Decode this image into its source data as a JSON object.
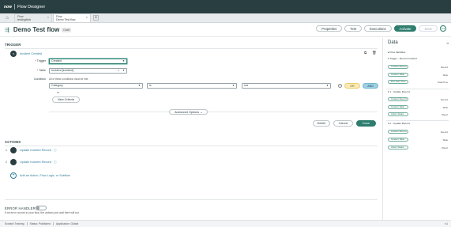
{
  "topbar": {
    "brand": "now",
    "title": "Flow Designer"
  },
  "tabs": [
    {
      "line1": "Flow",
      "line2": "testingHub",
      "active": false
    },
    {
      "line1": "Flow",
      "line2": "Demo Test flow",
      "active": true
    }
  ],
  "header": {
    "title": "Demo Test flow",
    "status": "Draft",
    "buttons": {
      "properties": "Properties",
      "test": "Test",
      "executions": "Executions",
      "activate": "Activate",
      "save": "Save"
    }
  },
  "trigger": {
    "section": "TRIGGER",
    "name": "Incident Created",
    "trigger_label": "Trigger",
    "trigger_value": "Created",
    "table_label": "Table",
    "table_value": "Incident [incident]",
    "condition_label": "Condition",
    "condition_hint": "All of these conditions must be met",
    "condition": {
      "field": "Category",
      "operator": "is",
      "value": "n/a"
    },
    "or_label": "OR",
    "and_label": "AND",
    "or_text": "or",
    "new_criteria": "New Criteria",
    "advanced": "Advanced Options",
    "delete": "Delete",
    "cancel": "Cancel",
    "done": "Done"
  },
  "actions": {
    "section": "ACTIONS",
    "items": [
      {
        "num": "1",
        "name": "Update Incident Record"
      },
      {
        "num": "2",
        "name": "Update Incident Record"
      }
    ],
    "add_label": "Add an Action, Flow Logic, or Subflow"
  },
  "error_handler": {
    "label": "ERROR HANDLER",
    "desc": "If an error occurs in your flow, the actions you add here will run.",
    "enabled": false
  },
  "data_panel": {
    "title": "Data",
    "groups": [
      {
        "label": "Flow Variables",
        "pills": []
      },
      {
        "label": "Trigger - Record Created",
        "pills": [
          {
            "label": "Incident Record",
            "type": "Record"
          },
          {
            "label": "Incident Table",
            "type": "Table"
          },
          {
            "label": "Run Start Time",
            "type": "Date/Time"
          }
        ]
      },
      {
        "label": "1 - Update Record",
        "pills": [
          {
            "label": "Incident Record",
            "type": "Record"
          },
          {
            "label": "Incident Table",
            "type": "Table"
          },
          {
            "label": "Action Status",
            "type": "Object"
          }
        ]
      },
      {
        "label": "2 - Update Record",
        "pills": [
          {
            "label": "Incident Record",
            "type": "Record"
          },
          {
            "label": "Incident Table",
            "type": "Table"
          },
          {
            "label": "Action Status",
            "type": "Object"
          }
        ]
      }
    ]
  },
  "statusbar": {
    "items": [
      "Scratch Training",
      "Status: Published",
      "Application: Global"
    ],
    "right": "v1"
  },
  "colors": {
    "accent": "#2e7d6f",
    "topbar": "#293e40",
    "link": "#2e7d9a"
  }
}
